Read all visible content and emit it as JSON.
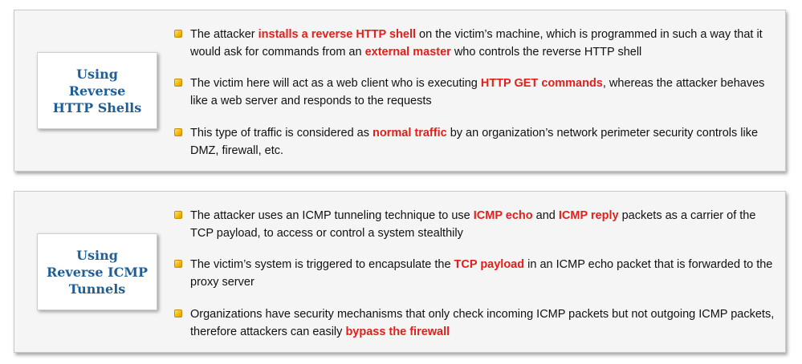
{
  "colors": {
    "accent_blue": "#1f5f96",
    "highlight_red": "#e0201a",
    "bullet_yellow": "#f2b705"
  },
  "panels": [
    {
      "label": "Using\nReverse\nHTTP Shells",
      "bullets": [
        {
          "segments": [
            {
              "t": "The attacker "
            },
            {
              "t": "installs a reverse HTTP shell",
              "hl": true
            },
            {
              "t": " on the victim’s machine, which is programmed in such a way that it would ask for commands from an "
            },
            {
              "t": "external master",
              "hl": true
            },
            {
              "t": " who controls the reverse HTTP shell"
            }
          ]
        },
        {
          "segments": [
            {
              "t": "The victim here will act as a web client who is executing "
            },
            {
              "t": "HTTP GET commands",
              "hl": true
            },
            {
              "t": ", whereas the attacker behaves like a web server and responds to the requests"
            }
          ]
        },
        {
          "segments": [
            {
              "t": "This type of traffic is considered as "
            },
            {
              "t": "normal traffic",
              "hl": true
            },
            {
              "t": " by an organization’s network perimeter security controls like DMZ, firewall, etc."
            }
          ]
        }
      ]
    },
    {
      "label": "Using\nReverse ICMP\nTunnels",
      "bullets": [
        {
          "segments": [
            {
              "t": "The attacker uses an ICMP tunneling technique to use "
            },
            {
              "t": "ICMP echo",
              "hl": true
            },
            {
              "t": " and "
            },
            {
              "t": "ICMP reply",
              "hl": true
            },
            {
              "t": " packets as a carrier of the TCP payload, to access or control a system stealthily"
            }
          ]
        },
        {
          "segments": [
            {
              "t": "The victim’s system is triggered to encapsulate the "
            },
            {
              "t": "TCP payload",
              "hl": true
            },
            {
              "t": " in an ICMP echo packet that is forwarded to the proxy server"
            }
          ]
        },
        {
          "segments": [
            {
              "t": "Organizations have security mechanisms that only check incoming ICMP packets but not outgoing ICMP packets, therefore attackers can easily "
            },
            {
              "t": "bypass the firewall",
              "hl": true
            }
          ]
        }
      ]
    }
  ]
}
